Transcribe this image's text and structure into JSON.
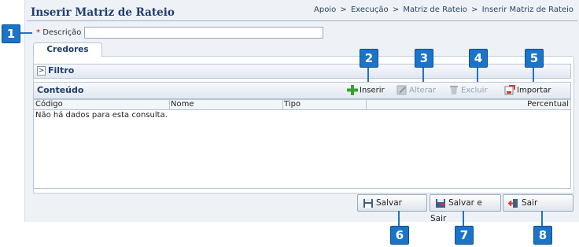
{
  "header": {
    "title": "Inserir Matriz de Rateio",
    "breadcrumb": [
      "Apoio",
      "Execução",
      "Matriz de Rateio",
      "Inserir Matriz de Rateio"
    ],
    "separator": ">"
  },
  "form": {
    "required_mark": "*",
    "descricao_label": "Descrição",
    "descricao_value": ""
  },
  "tabs": [
    {
      "label": "Credores"
    }
  ],
  "filter": {
    "label": "Filtro"
  },
  "content": {
    "label": "Conteúdo",
    "toolbar": [
      {
        "label": "Inserir",
        "icon": "plus-icon",
        "enabled": true
      },
      {
        "label": "Alterar",
        "icon": "edit-icon",
        "enabled": false
      },
      {
        "label": "Excluir",
        "icon": "trash-icon",
        "enabled": false
      },
      {
        "label": "Importar",
        "icon": "import-icon",
        "enabled": true
      }
    ],
    "columns": [
      "Código",
      "Nome",
      "Tipo",
      "",
      "Percentual"
    ],
    "empty_message": "Não há dados para esta consulta."
  },
  "footer": {
    "save_label": "Salvar",
    "save_exit_label": "Salvar e Sair",
    "exit_label": "Sair"
  },
  "callouts": [
    "1",
    "2",
    "3",
    "4",
    "5",
    "6",
    "7",
    "8"
  ],
  "colors": {
    "callout": "#1c74c9",
    "title": "#1f3d6d",
    "plus": "#3aa035"
  }
}
